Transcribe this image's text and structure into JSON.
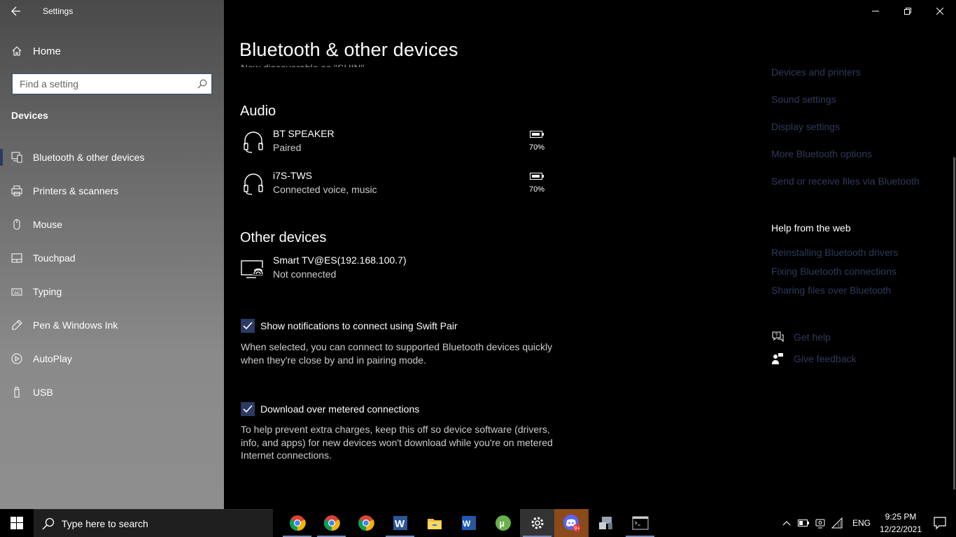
{
  "app": {
    "title": "Settings"
  },
  "sidebar": {
    "home_label": "Home",
    "search_placeholder": "Find a setting",
    "section": "Devices",
    "items": [
      {
        "label": "Bluetooth & other devices",
        "icon": "bluetooth-devices-icon",
        "active": true
      },
      {
        "label": "Printers & scanners",
        "icon": "printer-icon"
      },
      {
        "label": "Mouse",
        "icon": "mouse-icon"
      },
      {
        "label": "Touchpad",
        "icon": "touchpad-icon"
      },
      {
        "label": "Typing",
        "icon": "keyboard-icon"
      },
      {
        "label": "Pen & Windows Ink",
        "icon": "pen-icon"
      },
      {
        "label": "AutoPlay",
        "icon": "autoplay-icon"
      },
      {
        "label": "USB",
        "icon": "usb-icon"
      }
    ]
  },
  "main": {
    "title": "Bluetooth & other devices",
    "discoverable_text": "Now discoverable as \"SHIN\"",
    "audio": {
      "title": "Audio",
      "devices": [
        {
          "name": "BT SPEAKER",
          "status": "Paired",
          "battery": "70%",
          "icon": "headset-icon"
        },
        {
          "name": "i7S-TWS",
          "status": "Connected voice, music",
          "battery": "70%",
          "icon": "headset-icon"
        }
      ]
    },
    "other": {
      "title": "Other devices",
      "devices": [
        {
          "name": "Smart TV@ES(192.168.100.7)",
          "status": "Not connected",
          "icon": "wireless-display-icon"
        }
      ]
    },
    "swift_pair": {
      "label": "Show notifications to connect using Swift Pair",
      "checked": true,
      "description": "When selected, you can connect to supported Bluetooth devices quickly when they're close by and in pairing mode."
    },
    "metered": {
      "label": "Download over metered connections",
      "checked": true,
      "description": "To help prevent extra charges, keep this off so device software (drivers, info, and apps) for new devices won't download while you're on metered Internet connections."
    }
  },
  "related": {
    "links": [
      "Devices and printers",
      "Sound settings",
      "Display settings",
      "More Bluetooth options",
      "Send or receive files via Bluetooth"
    ],
    "help_title": "Help from the web",
    "help_links": [
      "Reinstalling Bluetooth drivers",
      "Fixing Bluetooth connections",
      "Sharing files over Bluetooth"
    ],
    "get_help": "Get help",
    "give_feedback": "Give feedback"
  },
  "taskbar": {
    "search_text": "Type here to search",
    "apps": [
      {
        "name": "chrome",
        "icon": "chrome-icon"
      },
      {
        "name": "chrome",
        "icon": "chrome-icon"
      },
      {
        "name": "chrome",
        "icon": "chrome-icon"
      },
      {
        "name": "word",
        "icon": "word-icon"
      },
      {
        "name": "file-explorer",
        "icon": "folder-icon"
      },
      {
        "name": "word",
        "icon": "word-icon"
      },
      {
        "name": "utorrent",
        "icon": "utorrent-icon"
      },
      {
        "name": "settings",
        "icon": "gear-icon"
      },
      {
        "name": "discord",
        "icon": "discord-icon",
        "badge": "9+"
      },
      {
        "name": "devices",
        "icon": "devices-icon"
      },
      {
        "name": "command-prompt",
        "icon": "terminal-icon"
      }
    ],
    "language": "ENG",
    "time": "9:25 PM",
    "date": "12/22/2021"
  },
  "colors": {
    "accent": "#2b3a64",
    "link": "#2f3a5a",
    "background": "#000000"
  }
}
